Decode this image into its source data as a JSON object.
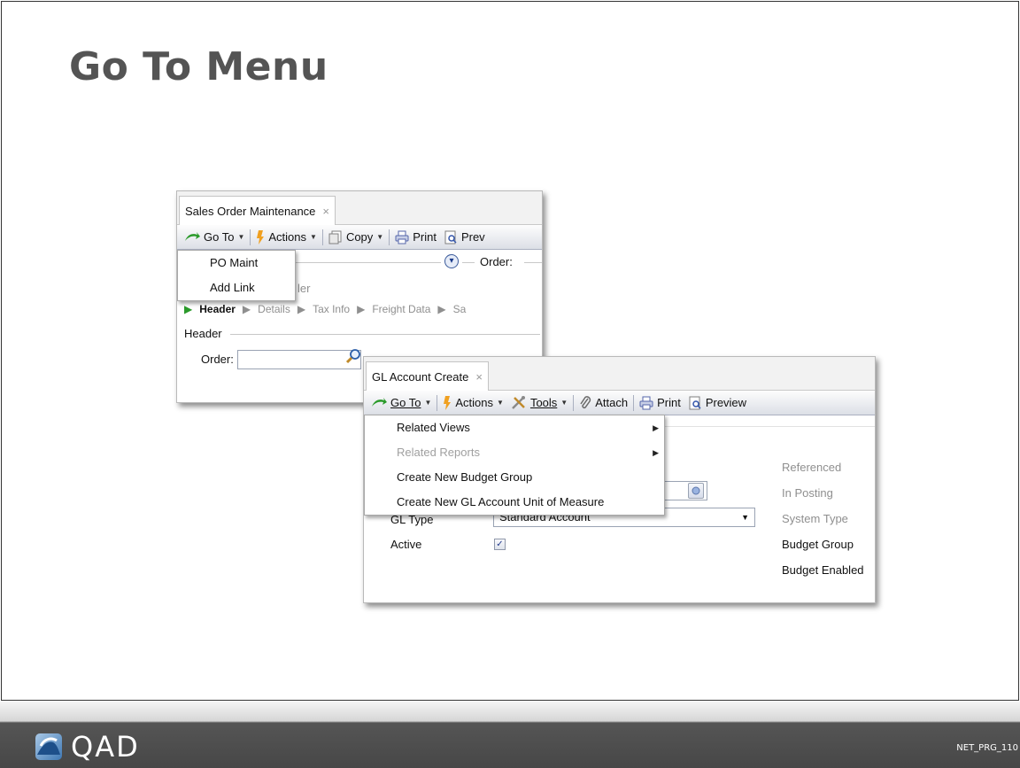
{
  "slide": {
    "title": "Go To Menu",
    "brand": "QAD",
    "code": "NET_PRG_110"
  },
  "colors": {
    "title_text": "#545454",
    "footer_bg": "#474747",
    "arrow_green": "#2a9a2a",
    "icon_orange": "#f0a020"
  },
  "window_sales_order": {
    "tab_title": "Sales Order Maintenance",
    "tab_close": "×",
    "toolbar": {
      "goto_label": "Go To",
      "actions_label": "Actions",
      "copy_label": "Copy",
      "print_label": "Print",
      "preview_label": "Prev"
    },
    "goto_menu": [
      "PO Maint",
      "Add Link"
    ],
    "order_field_label": "Order:",
    "partial_text": "ler",
    "steps": [
      "Header",
      "Details",
      "Tax Info",
      "Freight Data",
      "Sa"
    ],
    "section_label": "Header",
    "order_input_label": "Order:"
  },
  "window_gl_account": {
    "tab_title": "GL Account Create",
    "tab_close": "×",
    "toolbar": {
      "goto_label": "Go To",
      "actions_label": "Actions",
      "tools_label": "Tools",
      "attach_label": "Attach",
      "print_label": "Print",
      "preview_label": "Preview"
    },
    "goto_menu": [
      {
        "label": "Related Views",
        "submenu": true,
        "disabled": false
      },
      {
        "label": "Related Reports",
        "submenu": true,
        "disabled": true
      },
      {
        "label": "Create New Budget Group",
        "submenu": false,
        "disabled": false
      },
      {
        "label": "Create New GL Account Unit of Measure",
        "submenu": false,
        "disabled": false
      }
    ],
    "gl_type_label": "GL Type",
    "gl_type_value": "Standard Account",
    "active_label": "Active",
    "active_checked": true,
    "checkmark": "✓",
    "right_labels": [
      {
        "label": "Referenced",
        "greyed": true
      },
      {
        "label": "In Posting",
        "greyed": true
      },
      {
        "label": "System Type",
        "greyed": true
      },
      {
        "label": "Budget Group",
        "greyed": false
      },
      {
        "label": "Budget Enabled",
        "greyed": false
      }
    ]
  }
}
